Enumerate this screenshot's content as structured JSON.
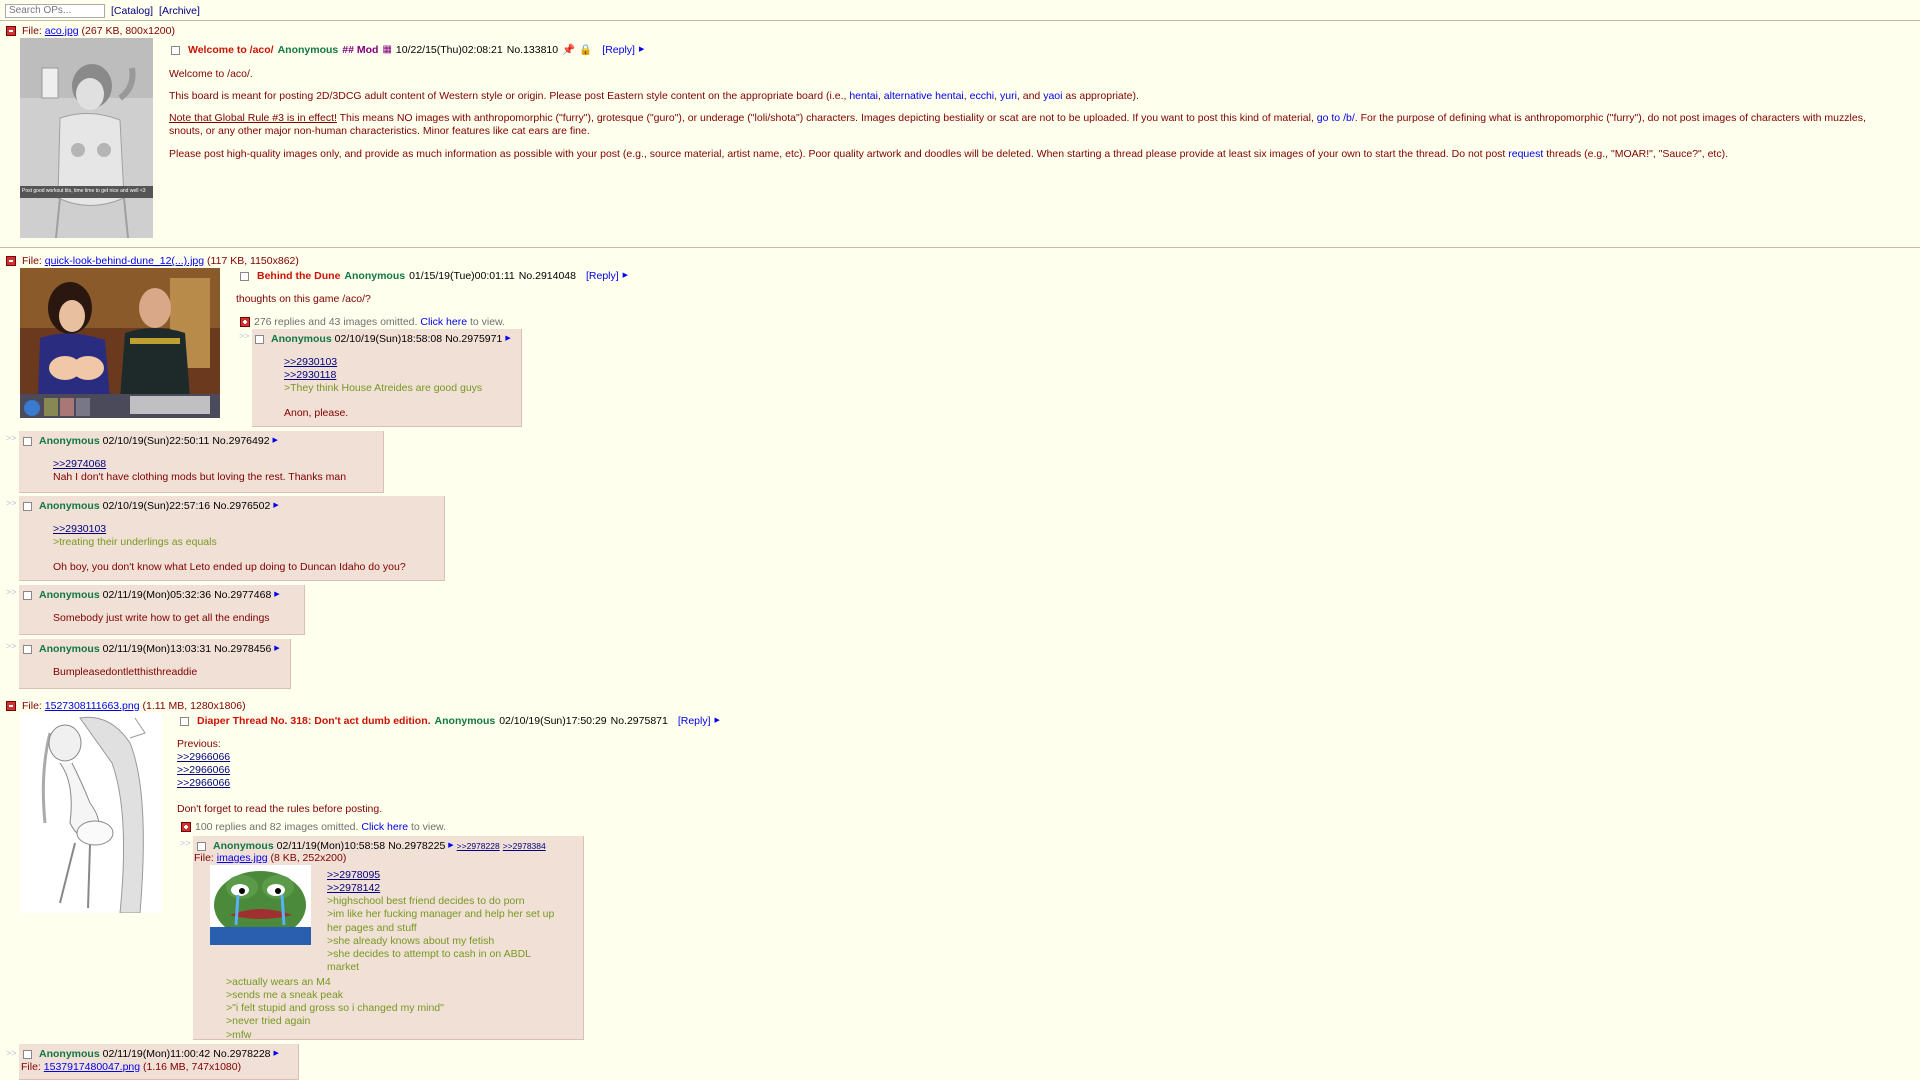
{
  "topbar": {
    "search_placeholder": "Search OPs...",
    "catalog": "[Catalog]",
    "archive": "[Archive]"
  },
  "t1": {
    "file_label": "File: ",
    "file_name": "aco.jpg",
    "file_meta": " (267 KB, 800x1200)",
    "thumb_caption": "Post good workout tits, time time to get nice and well <3",
    "subject": "Welcome to /aco/",
    "name": "Anonymous",
    "mod": "## Mod",
    "date": "10/22/15(Thu)02:08:21",
    "no": "No.133810",
    "reply": "[Reply]",
    "p1": "Welcome to /aco/.",
    "p2a": "This board is meant for posting 2D/3DCG adult content of Western style or origin. Please post Eastern style content on the appropriate board (i.e., ",
    "l_hentai": "hentai",
    "l_alt": "alternative hentai",
    "l_ecchi": "ecchi",
    "l_yuri": "yuri",
    "l_yaoi": "yaoi",
    "p2b": " as appropriate).",
    "p3a": "Note that Global Rule #3 is in effect!",
    "p3b": " This means NO images with anthropomorphic (\"furry\"), grotesque (\"guro\"), or underage (\"loli/shota\") characters. Images depicting bestiality or scat are not to be uploaded. If you want to post this kind of material, ",
    "l_b": "go to /b/",
    "p3c": ". For the purpose of defining what is anthropomorphic (\"furry\"), do not post images of characters with muzzles, snouts, or any other major non-human characteristics. Minor features like cat ears are fine.",
    "p4a": "Please post high-quality images only, and provide as much information as possible with your post (e.g., source material, artist name, etc). Poor quality artwork and doodles will be deleted. When starting a thread please provide at least six images of your own to start the thread. Do not post ",
    "l_request": "request",
    "p4b": " threads (e.g., \"MOAR!\", \"Sauce?\", etc)."
  },
  "t2": {
    "file_label": "File: ",
    "file_name": "quick-look-behind-dune_12(...).jpg",
    "file_meta": " (117 KB, 1150x862)",
    "subject": "Behind the Dune",
    "name": "Anonymous",
    "date": "01/15/19(Tue)00:01:11",
    "no": "No.2914048",
    "reply": "[Reply]",
    "body": "thoughts on this game /aco/?",
    "omitted": "276 replies and 43 images omitted. ",
    "click": "Click here",
    "omitted2": " to view.",
    "replies": [
      {
        "name": "Anonymous",
        "date": "02/10/19(Sun)18:58:08",
        "no": "No.2975971",
        "lines": [
          {
            "t": ">>2930103",
            "k": "q"
          },
          {
            "t": ">>2930118",
            "k": "q"
          },
          {
            "t": ">They think House Atreides are good guys",
            "k": "g"
          },
          {
            "t": "",
            "k": "b"
          },
          {
            "t": "Anon, please.",
            "k": "n"
          }
        ]
      },
      {
        "name": "Anonymous",
        "date": "02/10/19(Sun)22:50:11",
        "no": "No.2976492",
        "lines": [
          {
            "t": ">>2974068",
            "k": "q"
          },
          {
            "t": "Nah I don't have clothing mods but loving the rest. Thanks man",
            "k": "n"
          }
        ]
      },
      {
        "name": "Anonymous",
        "date": "02/10/19(Sun)22:57:16",
        "no": "No.2976502",
        "lines": [
          {
            "t": ">>2930103",
            "k": "q"
          },
          {
            "t": ">treating their underlings as equals",
            "k": "g"
          },
          {
            "t": "",
            "k": "b"
          },
          {
            "t": "Oh boy, you don't know what Leto ended up doing to Duncan Idaho do you?",
            "k": "n"
          }
        ]
      },
      {
        "name": "Anonymous",
        "date": "02/11/19(Mon)05:32:36",
        "no": "No.2977468",
        "lines": [
          {
            "t": "Somebody just write how to get all the endings",
            "k": "n"
          }
        ]
      },
      {
        "name": "Anonymous",
        "date": "02/11/19(Mon)13:03:31",
        "no": "No.2978456",
        "lines": [
          {
            "t": "Bumpleasedontletthisthreaddie",
            "k": "n"
          }
        ]
      }
    ]
  },
  "t3": {
    "file_label": "File: ",
    "file_name": "1527308111663.png",
    "file_meta": " (1.11 MB, 1280x1806)",
    "subject": "Diaper Thread No. 318: Don't act dumb edition.",
    "name": "Anonymous",
    "date": "02/10/19(Sun)17:50:29",
    "no": "No.2975871",
    "reply": "[Reply]",
    "prev": "Previous:",
    "q1": ">>2966066",
    "q2": ">>2966066",
    "q3": ">>2966066",
    "rules": "Don't forget to read the rules before posting.",
    "omitted": "100 replies and 82 images omitted. ",
    "click": "Click here",
    "omitted2": " to view.",
    "r1": {
      "name": "Anonymous",
      "date": "02/11/19(Mon)10:58:58",
      "no": "No.2978225",
      "bl1": ">>2978228",
      "bl2": ">>2978384",
      "file_label": "File: ",
      "file_name": "images.jpg",
      "file_meta": " (8 KB, 252x200)",
      "q1": ">>2978095",
      "q2": ">>2978142",
      "g": [
        ">highschool best friend decides to do porn",
        ">im like her fucking manager and help her set up her pages and stuff",
        ">she already knows about my fetish",
        ">she decides to attempt to cash in on ABDL market",
        ">actually wears an M4",
        ">sends me a sneak peak",
        ">\"i felt stupid and gross so i changed my mind\"",
        ">never tried again",
        ">mfw"
      ]
    },
    "r2": {
      "name": "Anonymous",
      "date": "02/11/19(Mon)11:00:42",
      "no": "No.2978228",
      "file_label": "File: ",
      "file_name": "1537917480047.png",
      "file_meta": " (1.16 MB, 747x1080)"
    }
  },
  "colors": {
    "bg": "#ffffee",
    "post": "#f0e0d6",
    "name": "#117743",
    "subject": "#cc1105",
    "greentext": "#789922",
    "link": "#0000ee"
  }
}
